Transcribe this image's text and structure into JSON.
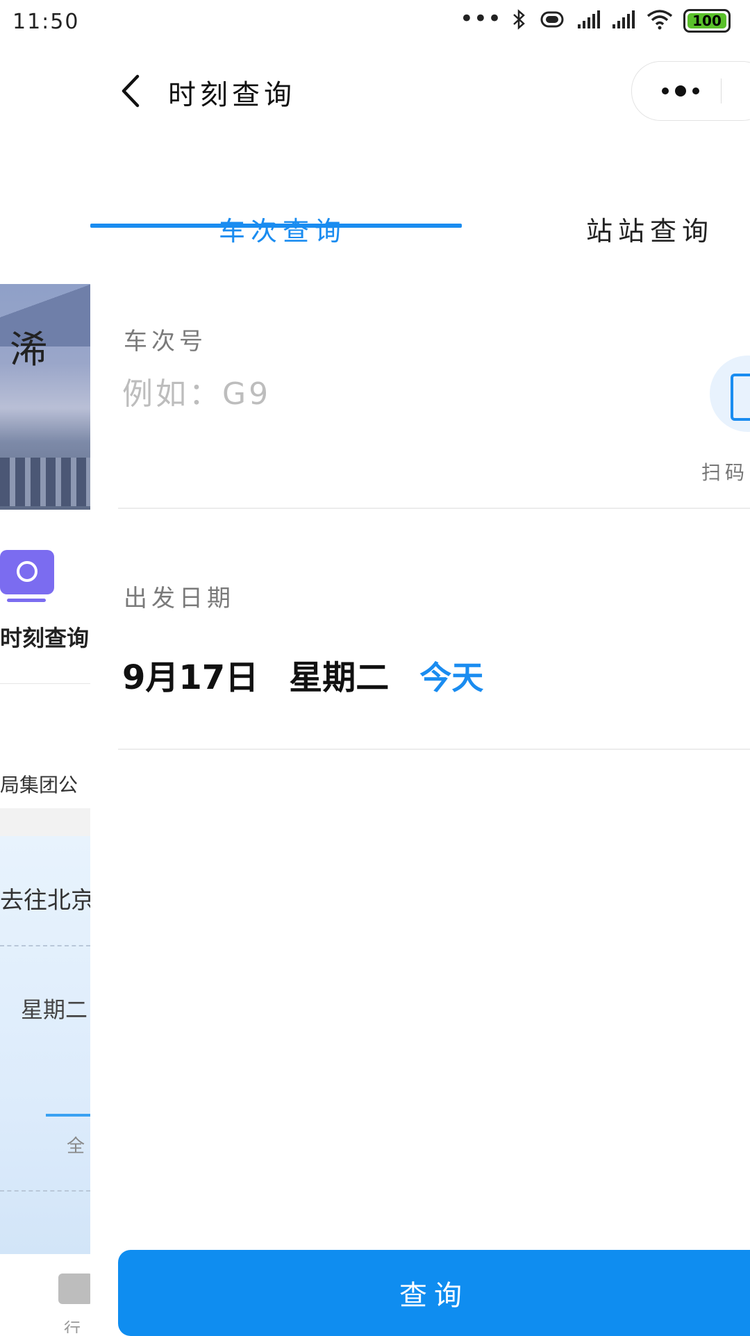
{
  "status_bar": {
    "time": "11:50",
    "battery": "100",
    "colors": {
      "battery_fill": "#5ac02a"
    }
  },
  "background_page": {
    "photo_text": "浠",
    "timetable_label": "时刻查询",
    "bureau_text": "局集团公",
    "direction_text": "去往北京",
    "weekday_text": "星期二",
    "all_text": "全",
    "bottom_nav_text": "行"
  },
  "nav": {
    "title": "时刻查询",
    "back_icon": "chevron-left-icon",
    "more_icon": "more-dots-icon"
  },
  "tabs": [
    {
      "label": "车次查询",
      "active": true
    },
    {
      "label": "站站查询",
      "active": false
    }
  ],
  "train_number": {
    "label": "车次号",
    "placeholder": "例如：G9",
    "value": "",
    "scan_label": "扫码",
    "scan_icon": "scan-icon"
  },
  "departure_date": {
    "label": "出发日期",
    "date": "9月17日",
    "weekday": "星期二",
    "today": "今天"
  },
  "query_button": {
    "label": "查询"
  },
  "colors": {
    "accent": "#1a8cf0",
    "button": "#0f8df0"
  }
}
